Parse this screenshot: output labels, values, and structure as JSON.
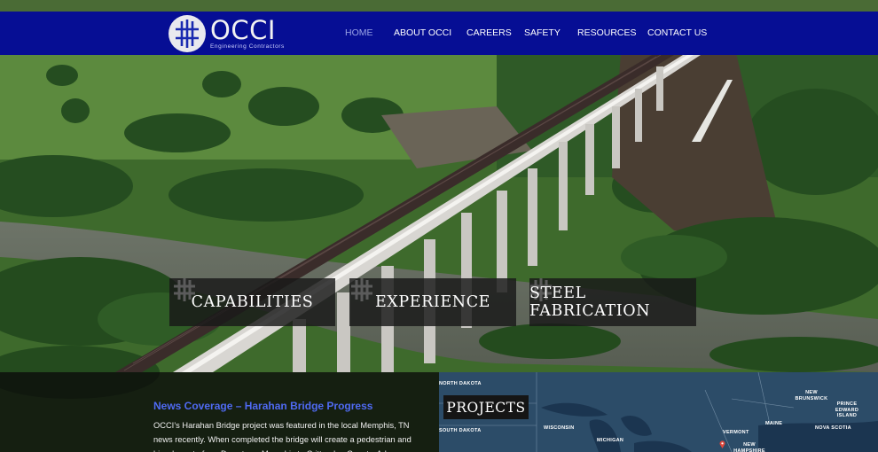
{
  "brand": {
    "name": "OCCI",
    "tagline": "Engineering Contractors",
    "colors": {
      "navbar": "#060e94",
      "news_title": "#4f6af2",
      "active_nav": "#9aa3e6"
    }
  },
  "nav": {
    "items": [
      {
        "label": "HOME",
        "active": true
      },
      {
        "label": "ABOUT OCCI",
        "active": false
      },
      {
        "label": "CAREERS",
        "active": false
      },
      {
        "label": "SAFETY",
        "active": false
      },
      {
        "label": "RESOURCES",
        "active": false
      },
      {
        "label": "CONTACT US",
        "active": false
      }
    ]
  },
  "tiles": [
    {
      "label": "CAPABILITIES",
      "icon": "hash-icon"
    },
    {
      "label": "EXPERIENCE",
      "icon": "hash-icon"
    },
    {
      "label": "STEEL FABRICATION",
      "icon": "hash-icon"
    }
  ],
  "news": {
    "title": "News Coverage – Harahan Bridge Progress",
    "body": "OCCI’s Harahan Bridge project was featured in the local Memphis, TN news recently.  When completed the bridge will create a pedestrian and bicycle route from Downtown Memphis to Crittenden County, Arkansas."
  },
  "projects": {
    "title": "PROJECTS",
    "map_labels": {
      "north_dakota": "NORTH DAKOTA",
      "south_dakota": "SOUTH DAKOTA",
      "wisconsin": "WISCONSIN",
      "michigan": "MICHIGAN",
      "vermont": "VERMONT",
      "maine": "MAINE",
      "new_brunswick": "NEW BRUNSWICK",
      "pei": "PRINCE EDWARD ISLAND",
      "nova_scotia": "NOVA SCOTIA",
      "new_hampshire": "NEW HAMPSHIRE"
    },
    "pin_icon": "map-pin-icon",
    "pin_color": "#e0483c"
  }
}
